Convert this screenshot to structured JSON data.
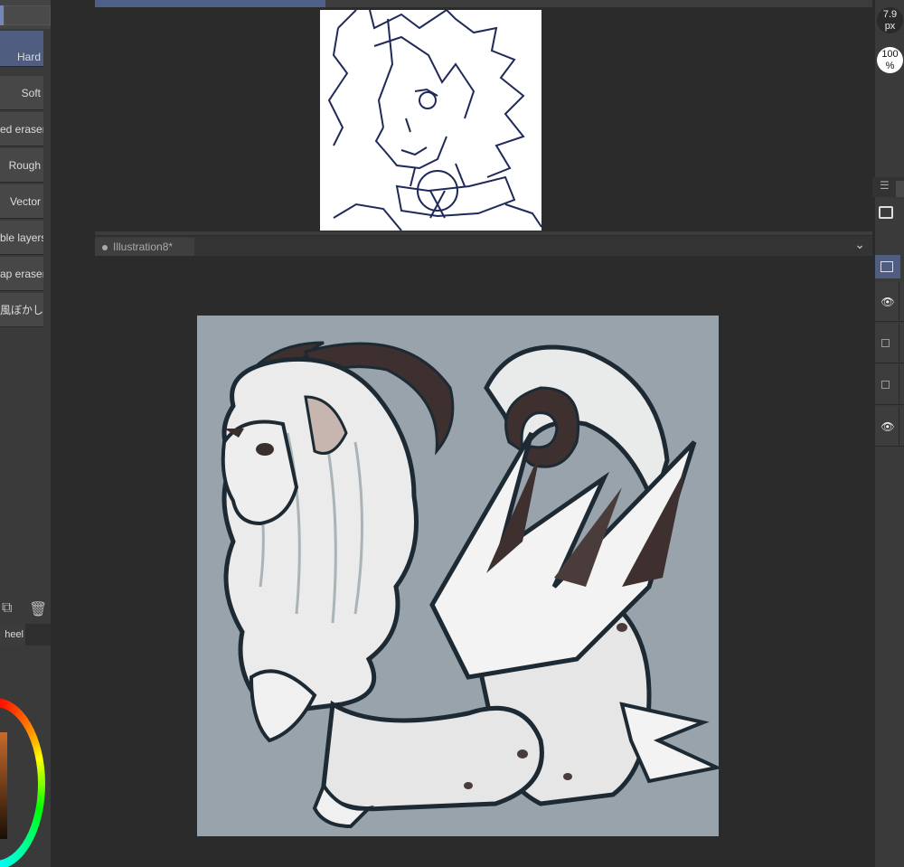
{
  "left_panel": {
    "eraser_tools": [
      {
        "label": "Hard",
        "active": true
      },
      {
        "label": "Soft",
        "active": false
      },
      {
        "label": "ed eraser",
        "active": false
      },
      {
        "label": "Rough",
        "active": false
      },
      {
        "label": "Vector",
        "active": false
      },
      {
        "label": "ble layers",
        "active": false
      },
      {
        "label": "ap eraser",
        "active": false
      },
      {
        "label": "風ぼかし",
        "active": false
      }
    ],
    "actions": [
      {
        "icon": "duplicate-icon",
        "glyph": "⧉"
      },
      {
        "icon": "trash-icon",
        "glyph": "🗑"
      }
    ],
    "color_tab_label": "heel"
  },
  "canvases": {
    "upper_document": {
      "tab_active": true
    },
    "lower_document": {
      "tab_label": "Illustration8*"
    }
  },
  "right_panel": {
    "brush_size": {
      "value": "7.9",
      "unit": "px"
    },
    "zoom": {
      "value": "100",
      "unit": "%"
    },
    "menu_glyph": "☰",
    "layers": [
      {
        "visible": true
      },
      {
        "visible": false
      },
      {
        "visible": false
      },
      {
        "visible": true
      }
    ]
  },
  "colors": {
    "accent": "#4f5d80",
    "panel_bg": "#3a3a3a",
    "workspace_bg": "#2b2b2b",
    "canvas_bg": "#98a3ab"
  }
}
